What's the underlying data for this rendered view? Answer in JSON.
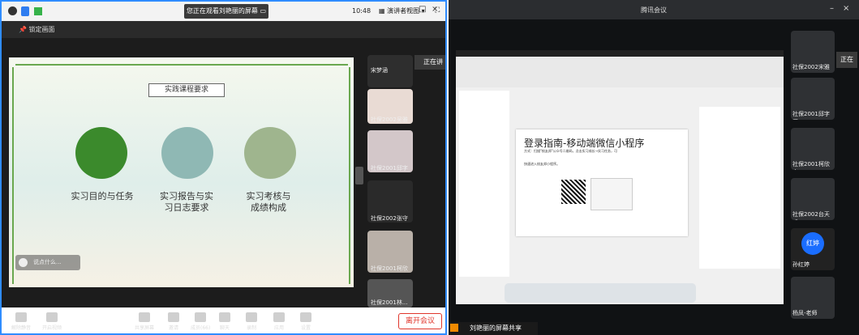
{
  "left": {
    "banner": "您正在观看刘艳丽的屏幕",
    "banner_icon": "menu-icon",
    "time": "10:48",
    "view_label": "演讲者视图",
    "lock_label": "锁定画面",
    "slide": {
      "heading": "实践课程要求",
      "items": [
        "实习目的与任务",
        "实习报告与实习日志要求",
        "实习考核与成绩构成"
      ]
    },
    "comment_placeholder": "说点什么...",
    "speaking_label": "正在讲",
    "participants": [
      "宋梦涵",
      "社保2002吴雅怡",
      "社保2001邱字画",
      "社保2002张守悦",
      "社保2001柯欣杰",
      "社保2001林..."
    ],
    "controls": [
      "解除静音",
      "开启视频",
      "共享屏幕",
      "邀请",
      "成员(66)",
      "聊天",
      "录制",
      "应用",
      "设置"
    ],
    "leave": "离开会议",
    "colors": {
      "accent": "#2f8cff",
      "leave": "#e0362c",
      "slide_green": "#6aa84f"
    }
  },
  "right": {
    "title": "腾讯会议",
    "doc_title": "登录指南-移动端微信小程序",
    "doc_line1": "方式：扫描\"校友邦\"公众号二维码，点击实习成长→实习任务，可",
    "doc_line2": "快速进入校友邦小程序。",
    "speaking_label": "正在",
    "participants": [
      "社保2002宋雅",
      "社保2001邱字画",
      "社保2001柯欣杰",
      "社保2002台天成",
      "孙红婷",
      "杨凤-老师"
    ],
    "avatar_text": "红婷",
    "share_label": "刘艳丽的屏幕共享",
    "colors": {
      "avatar": "#1a6dff",
      "share": "#f08a00"
    }
  }
}
